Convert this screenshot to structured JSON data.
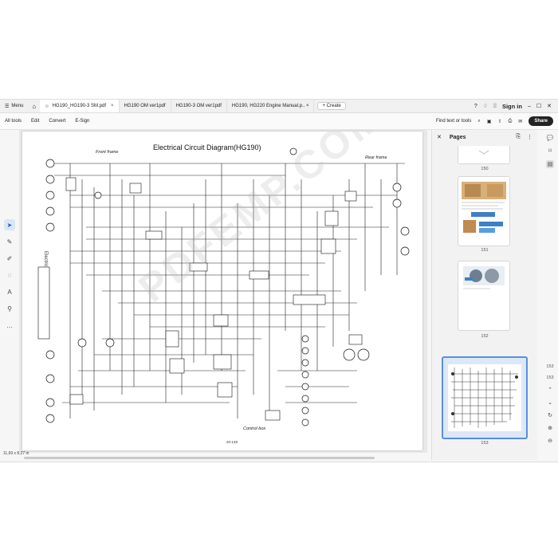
{
  "tabbar": {
    "menu_label": "Menu",
    "tabs": [
      {
        "label": "HG190_HG190-3 SM.pdf",
        "close": "×"
      },
      {
        "label": "HG190 OM ver1pdf"
      },
      {
        "label": "HG190-3 OM ver1pdf"
      },
      {
        "label": "HG190, HG220 Engine Manual.p.. ×"
      }
    ],
    "create_label": "+ Create",
    "sign_in": "Sign in"
  },
  "toolbar": {
    "items": [
      "All tools",
      "Edit",
      "Convert",
      "E-Sign"
    ],
    "find_placeholder": "Find text or tools",
    "share_label": "Share"
  },
  "document": {
    "title": "Electrical Circuit Diagram(HG190)",
    "labels": {
      "front_frame": "Front frame",
      "rear_frame": "Rear frame",
      "control_box": "Control box",
      "electric_box": "Electric control box"
    },
    "footer_page": "20-148",
    "watermark": "PDFEMP.COM",
    "status": "11,69 x 8,27 in"
  },
  "pages_panel": {
    "title": "Pages",
    "thumbs": [
      {
        "label": "150"
      },
      {
        "label": "151"
      },
      {
        "label": "152"
      },
      {
        "label": "153"
      }
    ]
  },
  "right_sidebar": {
    "page_current": "153",
    "page_total": "153"
  },
  "colors": {
    "accent": "#1a5fc9",
    "selection": "#5b8fe0"
  }
}
